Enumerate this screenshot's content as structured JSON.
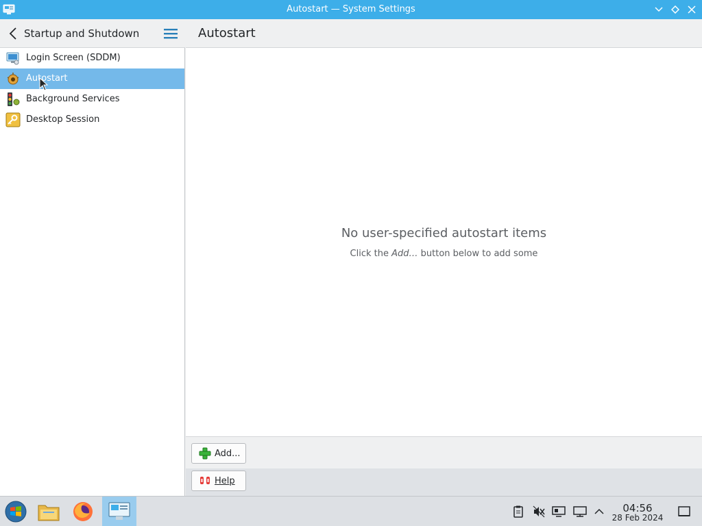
{
  "window": {
    "title": "Autostart — System Settings"
  },
  "sidebar": {
    "header_title": "Startup and Shutdown",
    "items": [
      {
        "label": "Login Screen (SDDM)",
        "icon": "login-screen-icon"
      },
      {
        "label": "Autostart",
        "icon": "autostart-icon",
        "selected": true
      },
      {
        "label": "Background Services",
        "icon": "background-services-icon"
      },
      {
        "label": "Desktop Session",
        "icon": "desktop-session-icon"
      }
    ]
  },
  "main": {
    "page_title": "Autostart",
    "empty_title": "No user-specified autostart items",
    "empty_sub_pre": "Click the ",
    "empty_sub_em": "Add…",
    "empty_sub_post": " button below to add some",
    "add_label": "Add...",
    "help_label": "Help"
  },
  "taskbar": {
    "apps": [
      "start-menu-icon",
      "file-manager-icon",
      "firefox-icon",
      "system-settings-icon"
    ],
    "time": "04:56",
    "date": "28 Feb 2024"
  },
  "colors": {
    "accent": "#3daee9",
    "selection": "#74b9ea"
  }
}
